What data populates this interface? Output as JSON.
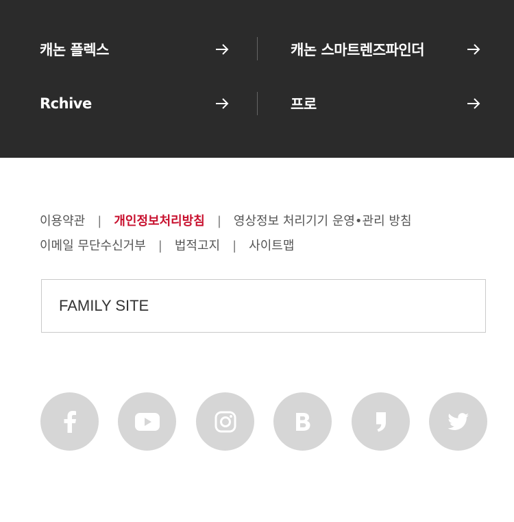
{
  "quick_links": [
    {
      "label": "캐논 플렉스"
    },
    {
      "label": "캐논 스마트렌즈파인더"
    },
    {
      "label": "Rchive"
    },
    {
      "label": "프로"
    }
  ],
  "footer_links": {
    "terms": "이용약관",
    "privacy": "개인정보처리방침",
    "video": "영상정보 처리기기 운영•관리 방침",
    "email_reject": "이메일 무단수신거부",
    "legal": "법적고지",
    "sitemap": "사이트맵",
    "separator": "|"
  },
  "family_site": {
    "label": "FAMILY SITE"
  },
  "social": [
    {
      "name": "facebook-icon"
    },
    {
      "name": "youtube-icon"
    },
    {
      "name": "instagram-icon"
    },
    {
      "name": "blog-icon"
    },
    {
      "name": "post-icon"
    },
    {
      "name": "twitter-icon"
    }
  ],
  "colors": {
    "top_background": "#2b2b2b",
    "accent": "#c8102e",
    "icon_circle": "#d6d6d6"
  }
}
